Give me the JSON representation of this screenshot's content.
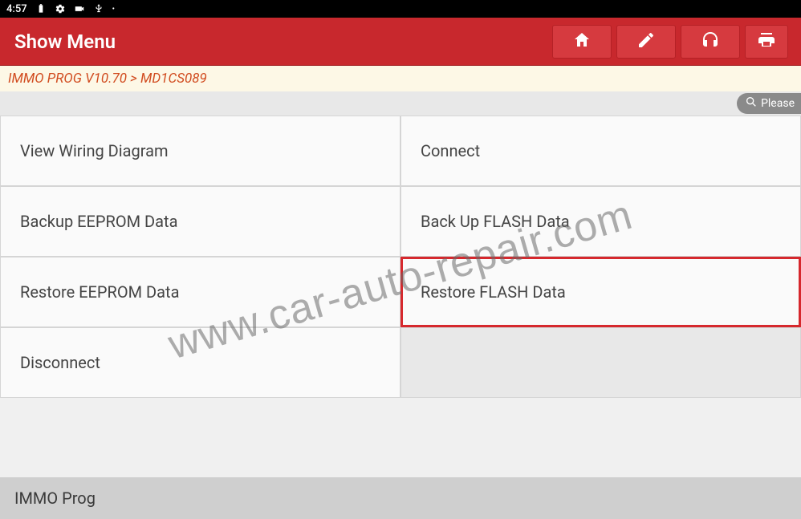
{
  "status": {
    "time": "4:57"
  },
  "header": {
    "title": "Show Menu"
  },
  "breadcrumb": {
    "text": "IMMO PROG V10.70 > MD1CS089"
  },
  "search": {
    "placeholder": "Please"
  },
  "menu": {
    "items": [
      {
        "label": "View Wiring Diagram",
        "selected": false
      },
      {
        "label": "Connect",
        "selected": false
      },
      {
        "label": "Backup EEPROM Data",
        "selected": false
      },
      {
        "label": "Back Up FLASH Data",
        "selected": false
      },
      {
        "label": "Restore EEPROM Data",
        "selected": false
      },
      {
        "label": "Restore FLASH Data",
        "selected": true
      },
      {
        "label": "Disconnect",
        "selected": false
      },
      {
        "label": "",
        "selected": false
      }
    ]
  },
  "footer": {
    "label": "IMMO Prog"
  },
  "watermark": {
    "text": "www.car-auto-repair.com"
  }
}
